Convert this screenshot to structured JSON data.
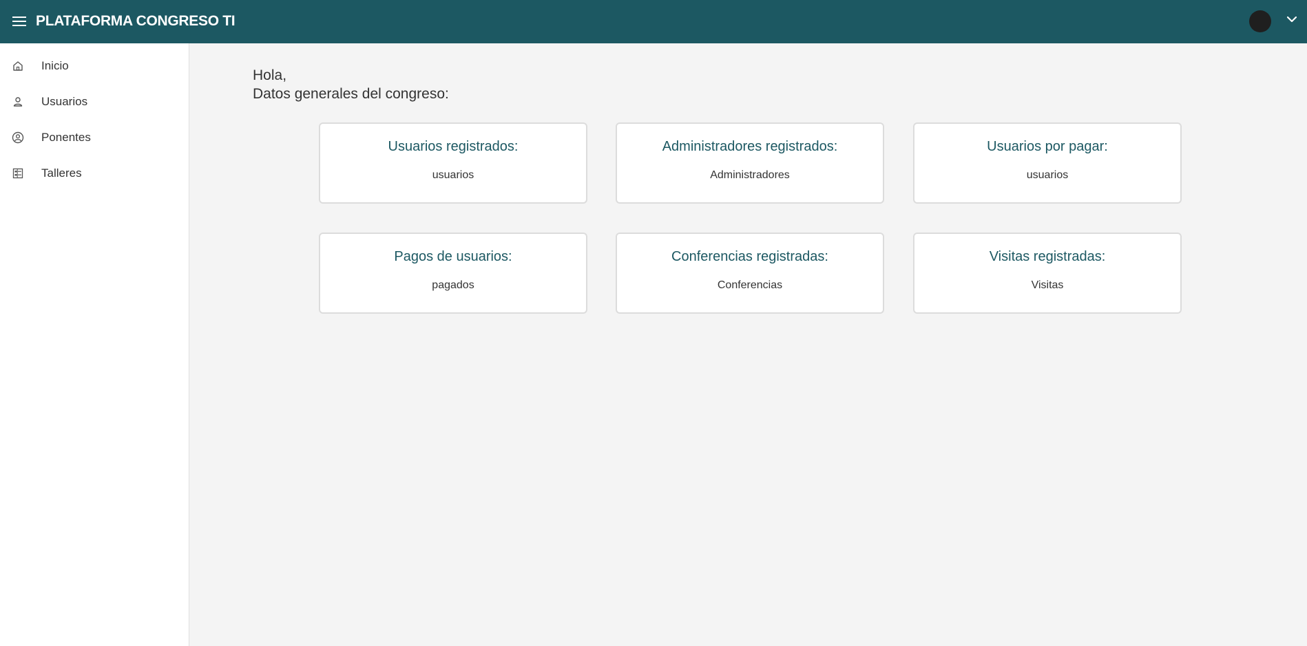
{
  "header": {
    "title": "PLATAFORMA CONGRESO TI",
    "menu_icon": "menu-icon",
    "avatar_icon": "avatar",
    "dropdown_icon": "chevron-down-icon",
    "background_color": "#1c5862"
  },
  "sidebar": {
    "items": [
      {
        "label": "Inicio",
        "icon": "home-icon"
      },
      {
        "label": "Usuarios",
        "icon": "user-icon"
      },
      {
        "label": "Ponentes",
        "icon": "user-circle-icon"
      },
      {
        "label": "Talleres",
        "icon": "list-icon"
      }
    ]
  },
  "main": {
    "greeting_line1": "Hola,",
    "greeting_line2": "Datos generales del congreso:",
    "cards": [
      {
        "title": "Usuarios registrados:",
        "value": "usuarios"
      },
      {
        "title": "Administradores registrados:",
        "value": "Administradores"
      },
      {
        "title": "Usuarios por pagar:",
        "value": "usuarios"
      },
      {
        "title": "Pagos de usuarios:",
        "value": "pagados"
      },
      {
        "title": "Conferencias registradas:",
        "value": "Conferencias"
      },
      {
        "title": "Visitas registradas:",
        "value": "Visitas"
      }
    ]
  },
  "colors": {
    "accent": "#1c5862",
    "background": "#f4f4f4",
    "card_border": "#dcdcdc"
  }
}
